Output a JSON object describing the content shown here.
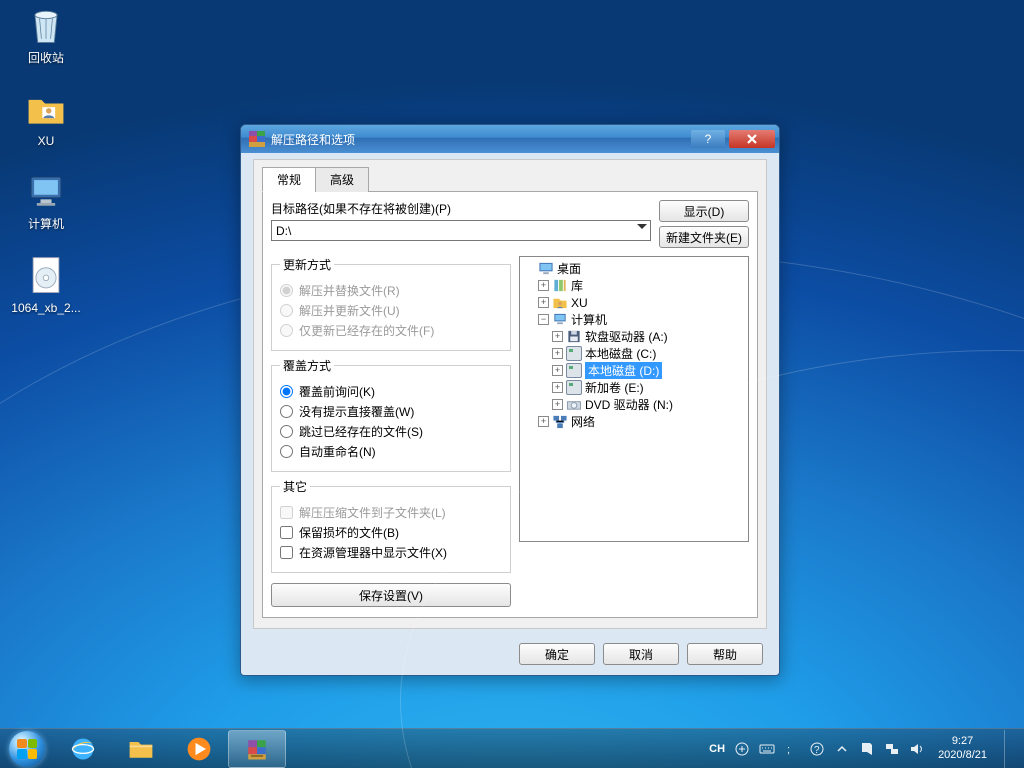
{
  "desktop": {
    "icons": [
      {
        "name": "recycle-bin",
        "label": "回收站"
      },
      {
        "name": "folder-xu",
        "label": "XU"
      },
      {
        "name": "computer",
        "label": "计算机"
      },
      {
        "name": "iso-file",
        "label": "1064_xb_2..."
      }
    ]
  },
  "dialog": {
    "title": "解压路径和选项",
    "tabs": {
      "general": "常规",
      "advanced": "高级"
    },
    "path_section": {
      "label": "目标路径(如果不存在将被创建)(P)",
      "value": "D:\\",
      "display_btn": "显示(D)",
      "new_folder_btn": "新建文件夹(E)"
    },
    "update_mode": {
      "legend": "更新方式",
      "opts": [
        {
          "label": "解压并替换文件(R)",
          "checked": true,
          "disabled": true
        },
        {
          "label": "解压并更新文件(U)",
          "checked": false,
          "disabled": true
        },
        {
          "label": "仅更新已经存在的文件(F)",
          "checked": false,
          "disabled": true
        }
      ]
    },
    "overwrite_mode": {
      "legend": "覆盖方式",
      "opts": [
        {
          "label": "覆盖前询问(K)",
          "checked": true
        },
        {
          "label": "没有提示直接覆盖(W)",
          "checked": false
        },
        {
          "label": "跳过已经存在的文件(S)",
          "checked": false
        },
        {
          "label": "自动重命名(N)",
          "checked": false
        }
      ]
    },
    "misc": {
      "legend": "其它",
      "opts": [
        {
          "label": "解压压缩文件到子文件夹(L)",
          "checked": false,
          "disabled": true
        },
        {
          "label": "保留损坏的文件(B)",
          "checked": false
        },
        {
          "label": "在资源管理器中显示文件(X)",
          "checked": false
        }
      ]
    },
    "save_settings": "保存设置(V)",
    "tree": {
      "desktop": "桌面",
      "libraries": "库",
      "xu": "XU",
      "computer": "计算机",
      "floppy": "软盘驱动器 (A:)",
      "local_c": "本地磁盘 (C:)",
      "local_d": "本地磁盘 (D:)",
      "new_vol_e": "新加卷 (E:)",
      "dvd_n": "DVD 驱动器 (N:)",
      "network": "网络"
    },
    "footer": {
      "ok": "确定",
      "cancel": "取消",
      "help": "帮助"
    }
  },
  "taskbar": {
    "lang": "CH",
    "time": "9:27",
    "date": "2020/8/21"
  }
}
